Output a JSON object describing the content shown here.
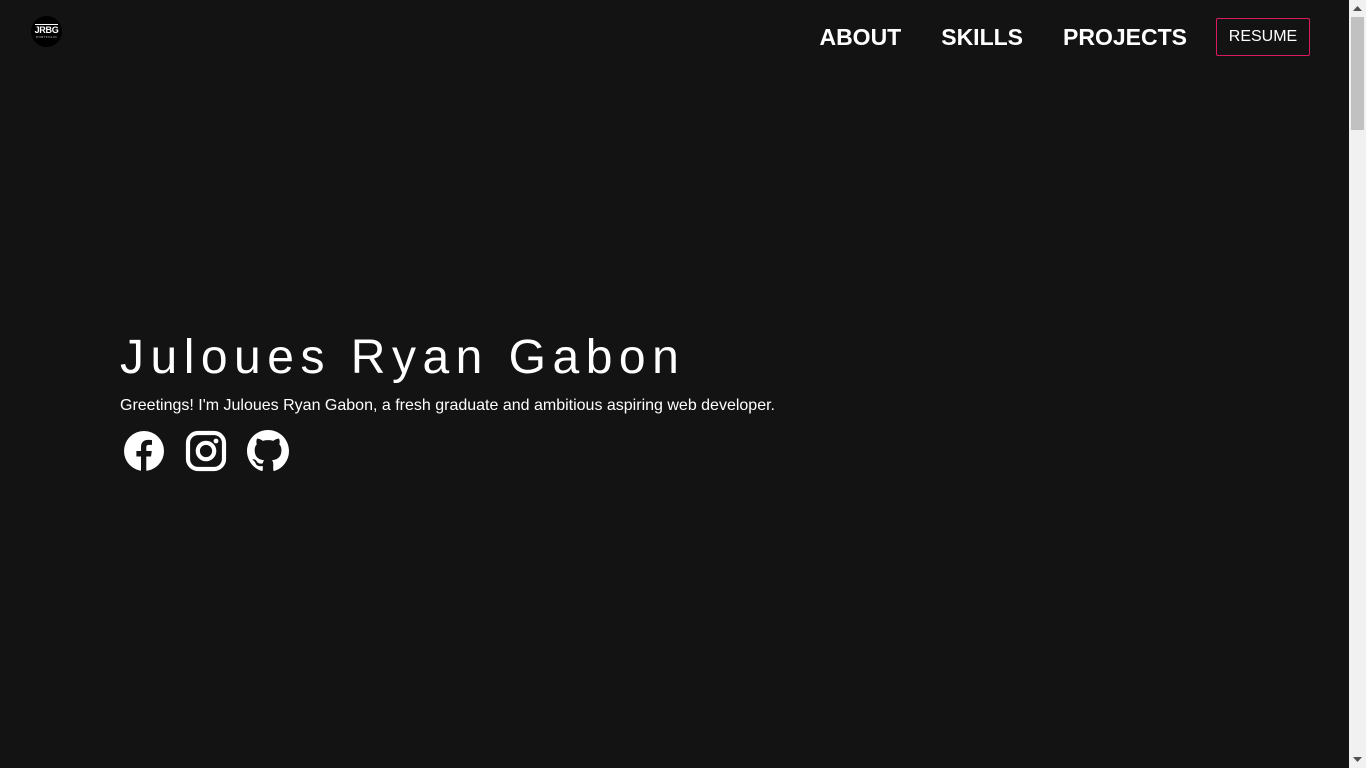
{
  "header": {
    "logo": {
      "mark": "JRBG",
      "sub": "PORTFOLIO"
    },
    "nav": [
      {
        "label": "ABOUT"
      },
      {
        "label": "SKILLS"
      },
      {
        "label": "PROJECTS"
      }
    ],
    "resume_label": "RESUME"
  },
  "hero": {
    "name": "Juloues Ryan Gabon",
    "tagline": "Greetings! I'm Juloues Ryan Gabon, a fresh graduate and ambitious aspiring web developer."
  },
  "socials": [
    {
      "icon": "facebook-icon"
    },
    {
      "icon": "instagram-icon"
    },
    {
      "icon": "github-icon"
    }
  ],
  "colors": {
    "background": "#131313",
    "text": "#ffffff",
    "resume_border": "#d81b60"
  }
}
